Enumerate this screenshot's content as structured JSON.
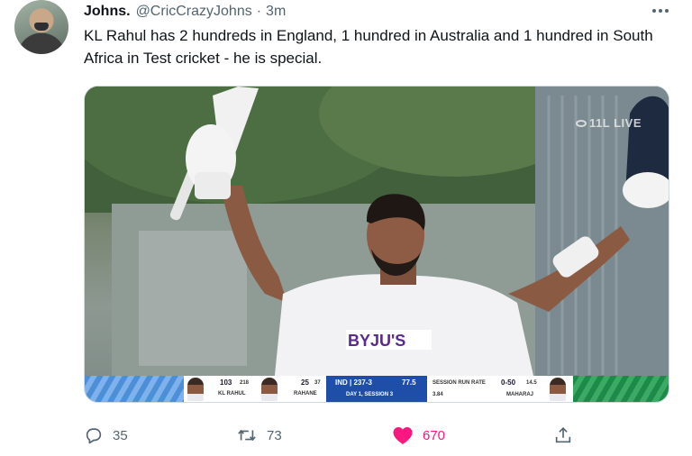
{
  "tweet": {
    "display_name": "Johns.",
    "handle": "@CricCrazyJohns",
    "separator": "·",
    "timestamp": "3m",
    "text": "KL Rahul has 2 hundreds in England, 1 hundred in Australia and 1 hundred in South Africa in Test cricket - he is special."
  },
  "media": {
    "broadcast_tag": "11L LIVE",
    "jersey_text": "BYJU'S",
    "scoreboard": {
      "batter1_runs": "103",
      "batter1_balls": "218",
      "batter1_name": "KL RAHUL",
      "batter2_runs": "25",
      "batter2_balls": "37",
      "batter2_name": "RAHANE",
      "team_score": "IND | 237-3",
      "overs": "77.5",
      "session": "DAY 1, SESSION 3",
      "session_label": "SESSION RUN RATE",
      "session_rate": "3.84",
      "bowler_figures": "0-50",
      "bowler_overs": "14.5",
      "bowler_name": "MAHARAJ"
    }
  },
  "actions": {
    "reply_count": "35",
    "retweet_count": "73",
    "like_count": "670",
    "like_color": "#f91880",
    "icons": [
      "reply-icon",
      "retweet-icon",
      "heart-icon",
      "share-icon"
    ]
  }
}
